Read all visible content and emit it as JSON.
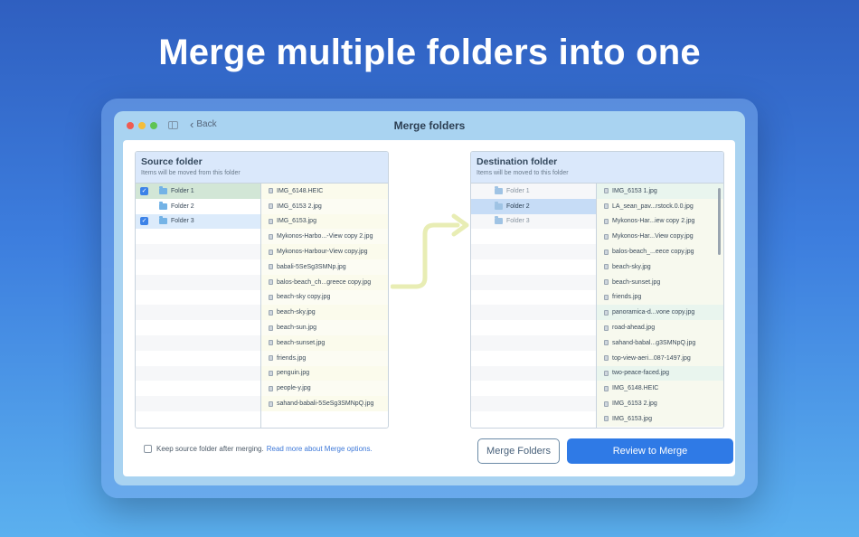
{
  "headline": "Merge multiple folders into one",
  "window": {
    "title": "Merge folders",
    "back_label": "Back"
  },
  "source": {
    "title": "Source folder",
    "subtitle": "Items will be moved from this folder",
    "folders": [
      {
        "name": "Folder 1",
        "checked": true,
        "selection": "green"
      },
      {
        "name": "Folder 2",
        "checked": false,
        "selection": "none"
      },
      {
        "name": "Folder 3",
        "checked": true,
        "selection": "blue"
      }
    ],
    "files": [
      "IMG_6148.HEIC",
      "IMG_6153 2.jpg",
      "IMG_6153.jpg",
      "Mykonos-Harbo...-View copy 2.jpg",
      "Mykonos-Harbour-View copy.jpg",
      "babali-5SeSg3SMNp.jpg",
      "balos-beach_ch...greece copy.jpg",
      "beach-sky copy.jpg",
      "beach-sky.jpg",
      "beach-sun.jpg",
      "beach-sunset.jpg",
      "friends.jpg",
      "penguin.jpg",
      "people-y.jpg",
      "sahand-babali-5SeSg3SMNpQ.jpg"
    ]
  },
  "destination": {
    "title": "Destination folder",
    "subtitle": "Items will be moved to this folder",
    "folders": [
      {
        "name": "Folder 1",
        "selection": "none"
      },
      {
        "name": "Folder 2",
        "selection": "dblue"
      },
      {
        "name": "Folder 3",
        "selection": "none"
      }
    ],
    "files": [
      "IMG_6153 1.jpg",
      "LA_sean_pav...rstock.0.0.jpg",
      "Mykonos-Har...iew copy 2.jpg",
      "Mykonos-Har...View copy.jpg",
      "balos-beach_...eece copy.jpg",
      "beach-sky.jpg",
      "beach-sunset.jpg",
      "friends.jpg",
      "panoramica-d...vone copy.jpg",
      "road-ahead.jpg",
      "sahand-babal...g3SMNpQ.jpg",
      "top-view-aeri...087-1497.jpg",
      "two-peace-faced.jpg",
      "IMG_6148.HEIC",
      "IMG_6153 2.jpg",
      "IMG_6153.jpg"
    ]
  },
  "footer": {
    "keep_label": "Keep source folder after merging.",
    "link_label": "Read more about Merge options.",
    "merge_button": "Merge Folders",
    "review_button": "Review to Merge"
  },
  "colors": {
    "accent": "#2f7ae6",
    "arrow": "#e8edb4"
  }
}
